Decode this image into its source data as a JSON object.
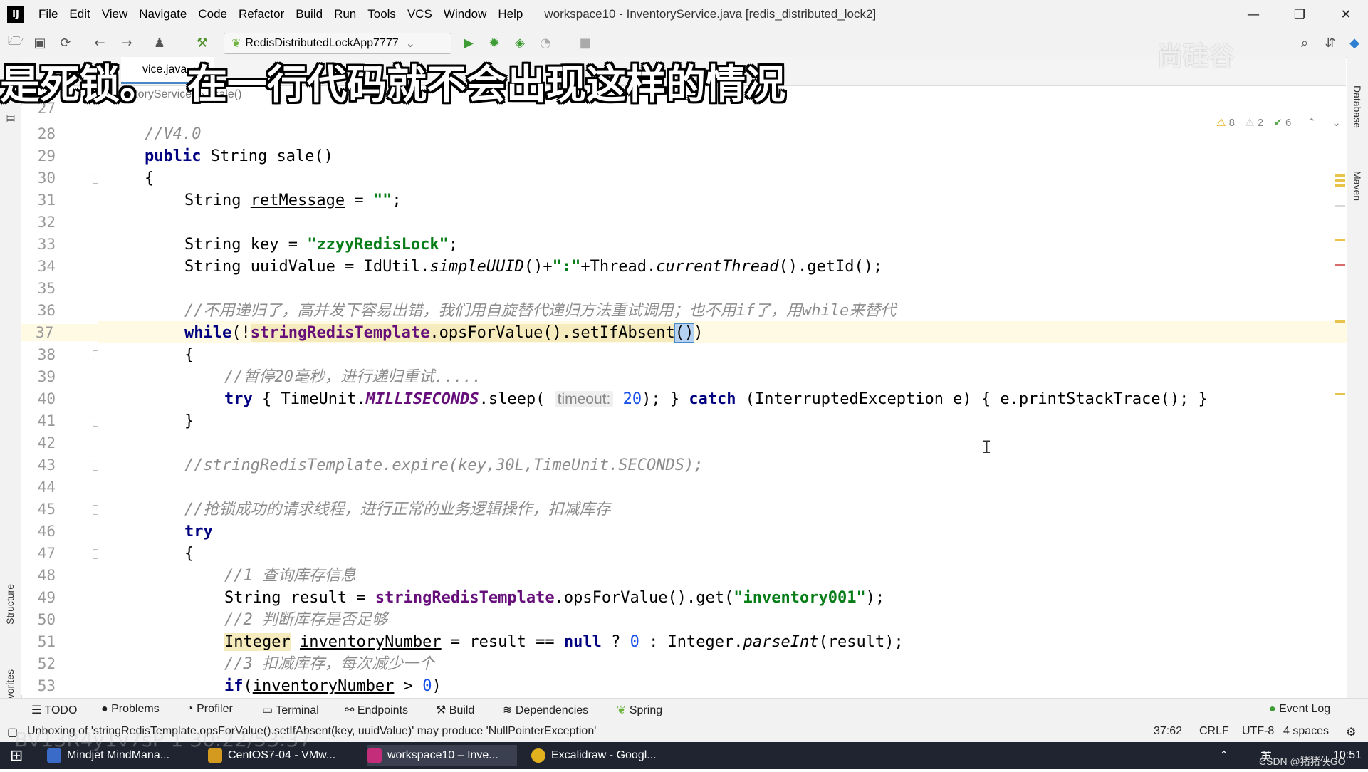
{
  "app": {
    "logo_text": "IJ",
    "menu": [
      "File",
      "Edit",
      "View",
      "Navigate",
      "Code",
      "Refactor",
      "Build",
      "Run",
      "Tools",
      "VCS",
      "Window",
      "Help"
    ],
    "window_title": "workspace10 - InventoryService.java [redis_distributed_lock2]"
  },
  "toolbar": {
    "run_config": "RedisDistributedLockApp7777"
  },
  "tabs": {
    "active_tab": "vice.java"
  },
  "breadcrumb": {
    "class": "InventoryService",
    "sep": "›",
    "method": "sale()"
  },
  "overlay": {
    "subtitle": "是死锁。  在一行代码就不会出现这样的情况",
    "watermark": "尚硅谷",
    "screen_watermark": "BV13R4y1v7sP 1  30:22/53:37"
  },
  "inspections": {
    "warnings": "8",
    "weak_warnings": "2",
    "typos": "6"
  },
  "editor": {
    "line_numbers": [
      "27",
      "28",
      "29",
      "30",
      "31",
      "32",
      "33",
      "34",
      "35",
      "36",
      "37",
      "38",
      "39",
      "40",
      "41",
      "42",
      "43",
      "44",
      "45",
      "46",
      "47",
      "48",
      "49",
      "50",
      "51",
      "52",
      "53"
    ],
    "l28": "//V4.0",
    "l29_kw": "public",
    "l29_rest": " String sale()",
    "l30": "{",
    "l31_a": "String ",
    "l31_var": "retMessage",
    "l31_b": " = ",
    "l31_str": "\"\"",
    "l31_c": ";",
    "l33_a": "String key = ",
    "l33_str": "\"zzyyRedisLock\"",
    "l33_b": ";",
    "l34_a": "String uuidValue = IdUtil.",
    "l34_m1": "simpleUUID",
    "l34_b": "()+",
    "l34_str": "\":\"",
    "l34_c": "+Thread.",
    "l34_m2": "currentThread",
    "l34_d": "().getId();",
    "l36": "//不用递归了，高并发下容易出错，我们用自旋替代递归方法重试调用；也不用if了，用while来替代",
    "l37_kw": "while",
    "l37_a": "(!",
    "l37_fld": "stringRedisTemplate",
    "l37_b": ".opsForValue().setIfAbsent",
    "l37_sel": "()",
    "l37_c": ")",
    "l38": "{",
    "l39": "//暂停20毫秒，进行递归重试.....",
    "l40_kw1": "try",
    "l40_a": " { TimeUnit.",
    "l40_stc": "MILLISECONDS",
    "l40_b": ".sleep( ",
    "l40_hint": "timeout:",
    "l40_num": " 20",
    "l40_c": "); } ",
    "l40_kw2": "catch",
    "l40_d": " (InterruptedException e) { e.printStackTrace(); }",
    "l41": "}",
    "l43": "//stringRedisTemplate.expire(key,30L,TimeUnit.SECONDS);",
    "l45": "//抢锁成功的请求线程，进行正常的业务逻辑操作，扣减库存",
    "l46_kw": "try",
    "l47": "{",
    "l48": "//1 查询库存信息",
    "l49_a": "String result = ",
    "l49_fld": "stringRedisTemplate",
    "l49_b": ".opsForValue().get(",
    "l49_str": "\"inventory001\"",
    "l49_c": ");",
    "l50": "//2 判断库存是否足够",
    "l51_type": "Integer",
    "l51_a": " ",
    "l51_var": "inventoryNumber",
    "l51_b": " = result == ",
    "l51_kw": "null",
    "l51_c": " ? ",
    "l51_num": "0",
    "l51_d": " : Integer.",
    "l51_m": "parseInt",
    "l51_e": "(result);",
    "l52": "//3 扣减库存，每次减少一个",
    "l53_kw": "if",
    "l53_a": "(",
    "l53_var": "inventoryNumber",
    "l53_b": " > ",
    "l53_num": "0",
    "l53_c": ")"
  },
  "side_panels": {
    "left": [
      "Structure",
      "Favorites"
    ],
    "right": [
      "Database",
      "Maven"
    ]
  },
  "tool_windows": [
    "TODO",
    "Problems",
    "Profiler",
    "Terminal",
    "Endpoints",
    "Build",
    "Dependencies",
    "Spring"
  ],
  "event_log": "Event Log",
  "status": {
    "message": "Unboxing of 'stringRedisTemplate.opsForValue().setIfAbsent(key, uuidValue)' may produce 'NullPointerException'",
    "position": "37:62",
    "line_sep": "CRLF",
    "encoding": "UTF-8",
    "indent": "4 spaces"
  },
  "taskbar": {
    "items": [
      "Mindjet MindMana...",
      "CentOS7-04 - VMw...",
      "workspace10 – Inve...",
      "Excalidraw - Googl..."
    ],
    "tray_ime": "英",
    "tray_watermark": "CSDN @猪猪侠GO",
    "clock": "10:51"
  },
  "colors": {
    "keyword": "#000080",
    "string": "#067d17",
    "comment": "#8c8c8c",
    "field": "#660e7a",
    "number": "#1750eb",
    "current_line": "#fffae3"
  }
}
